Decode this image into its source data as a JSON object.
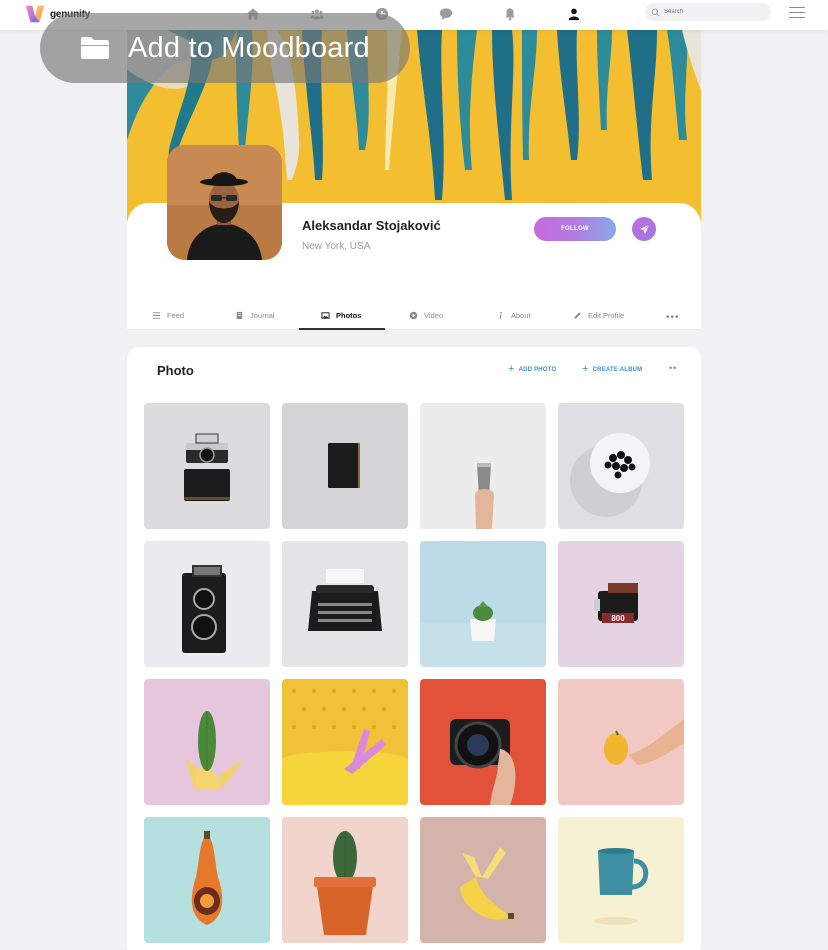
{
  "app": {
    "name": "genunity"
  },
  "nav": {
    "icons": [
      "home-icon",
      "community-icon",
      "add-icon",
      "chat-icon",
      "bell-icon",
      "profile-icon"
    ],
    "search_placeholder": "Search"
  },
  "overlay": {
    "label": "Add to Moodboard"
  },
  "profile": {
    "name": "Aleksandar Stojaković",
    "location": "New York, USA",
    "follow_label": "FOLLOW"
  },
  "tabs": [
    {
      "label": "Feed",
      "icon": "list-icon"
    },
    {
      "label": "Journal",
      "icon": "notebook-icon"
    },
    {
      "label": "Photos",
      "icon": "image-icon",
      "active": true
    },
    {
      "label": "Video",
      "icon": "play-icon"
    },
    {
      "label": "About",
      "icon": "info-icon"
    },
    {
      "label": "Edit Profile",
      "icon": "pencil-icon"
    }
  ],
  "photos": {
    "title": "Photo",
    "add_photo_label": "ADD PHOTO",
    "create_album_label": "CREATE ALBUM",
    "items": [
      "vintage camera",
      "black notebook",
      "hand holding metal cup",
      "plate of black berries",
      "twin-lens reflex camera",
      "typewriter",
      "potted succulent",
      "film roll 800",
      "cactus in banana peel",
      "legs in yellow bathtub",
      "hand holding camera",
      "hand holding squash",
      "carved butternut squash",
      "potted cactus",
      "peeled banana",
      "teal mug"
    ]
  },
  "colors": {
    "accent_gradient_start": "#c56bdf",
    "accent_gradient_end": "#89a9ea",
    "link_blue": "#3b8be0"
  }
}
